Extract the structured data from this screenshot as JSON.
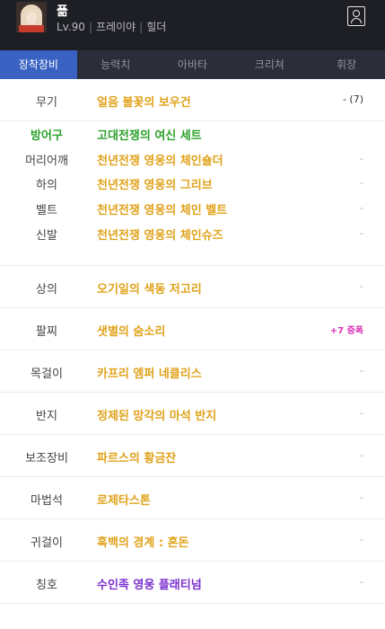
{
  "character": {
    "name": "픎",
    "level": "Lv.90",
    "class": "프레이야",
    "guild": "힐더"
  },
  "tabs": [
    "장착장비",
    "능력치",
    "아바타",
    "크리쳐",
    "휘장"
  ],
  "equipment": {
    "weapon": {
      "slot": "무기",
      "item": "얼음 불꽃의 보우건",
      "value": "- (7)"
    },
    "armor_set": {
      "title": "방어구",
      "set_name": "고대전쟁의 여신 세트",
      "pieces": [
        {
          "slot": "머리어깨",
          "item": "천년전쟁 영웅의 체인숄더",
          "value": "-"
        },
        {
          "slot": "하의",
          "item": "천년전쟁 영웅의 그리브",
          "value": "-"
        },
        {
          "slot": "벨트",
          "item": "천년전쟁 영웅의 체인 벨트",
          "value": "-"
        },
        {
          "slot": "신발",
          "item": "천년전쟁 영웅의 체인슈즈",
          "value": "-"
        }
      ]
    },
    "top": {
      "slot": "상의",
      "item": "오기일의 색동 저고리",
      "value": "-"
    },
    "bracelet": {
      "slot": "팔찌",
      "item": "샛별의 숨소리",
      "value": "+7 증폭"
    },
    "necklace": {
      "slot": "목걸이",
      "item": "카프리 엠퍼 네클리스",
      "value": "-"
    },
    "ring": {
      "slot": "반지",
      "item": "정제된 망각의 마석 반지",
      "value": "-"
    },
    "sub_equip": {
      "slot": "보조장비",
      "item": "파르스의 황금잔",
      "value": "-"
    },
    "magic_stone": {
      "slot": "마법석",
      "item": "로제타스톤",
      "value": "-"
    },
    "earring": {
      "slot": "귀걸이",
      "item": "흑백의 경계 : 혼돈",
      "value": "-"
    },
    "title": {
      "slot": "칭호",
      "item": "수인족 영웅 플래티넘",
      "value": "-"
    }
  }
}
